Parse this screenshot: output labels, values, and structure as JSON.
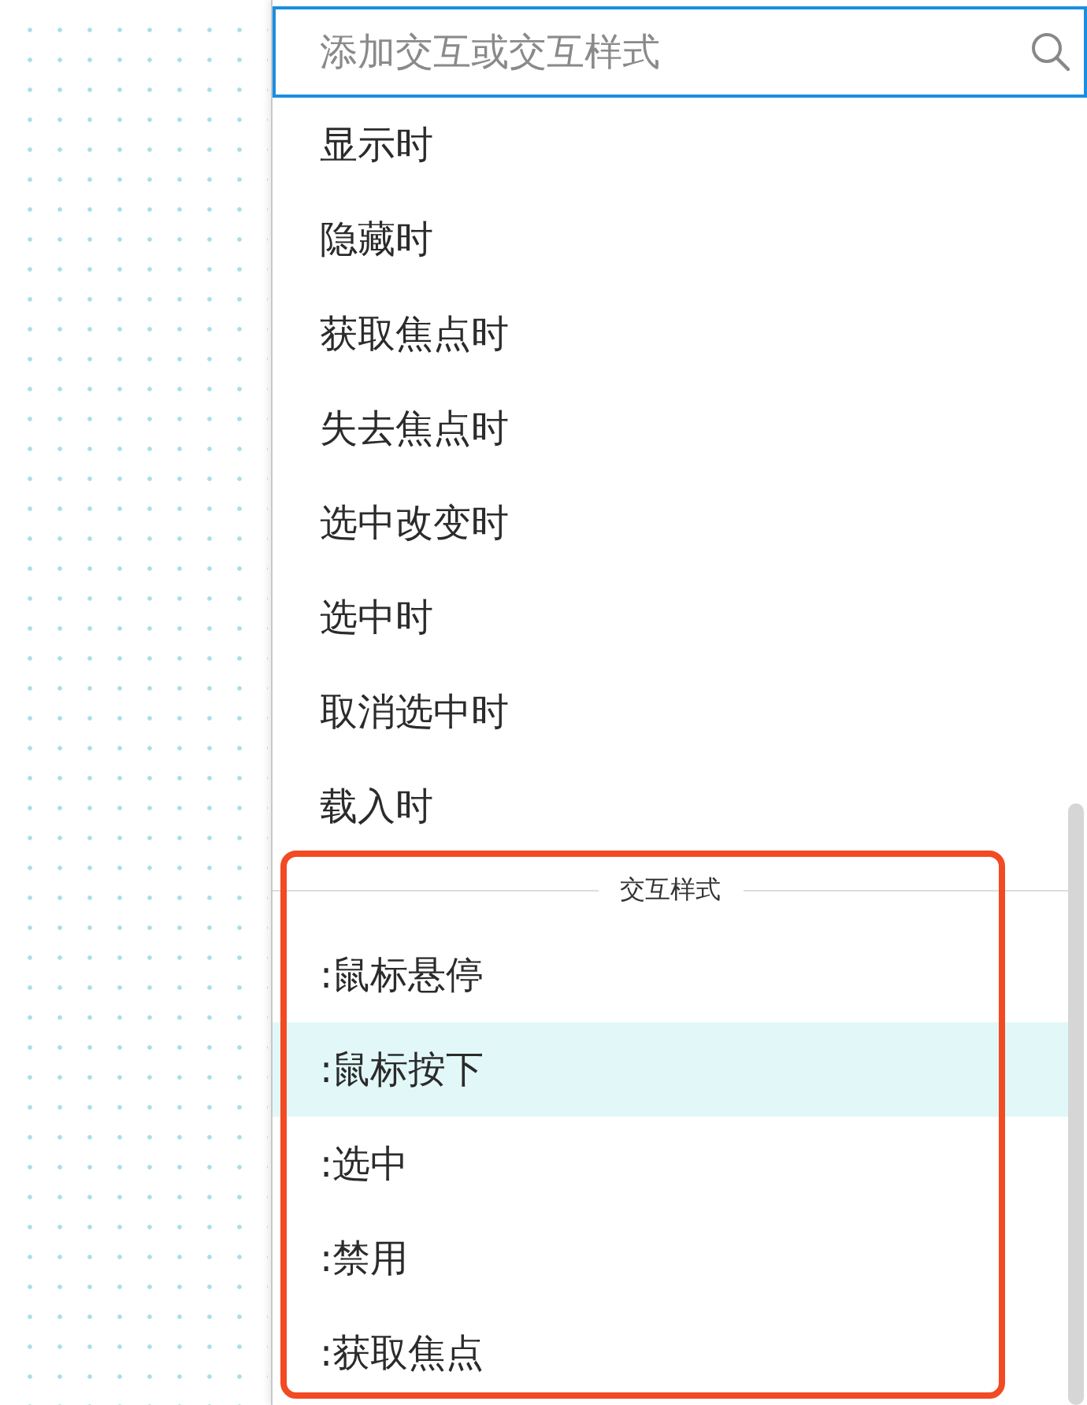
{
  "search": {
    "placeholder": "添加交互或交互样式"
  },
  "events": [
    {
      "label": "显示时"
    },
    {
      "label": "隐藏时"
    },
    {
      "label": "获取焦点时"
    },
    {
      "label": "失去焦点时"
    },
    {
      "label": "选中改变时"
    },
    {
      "label": "选中时"
    },
    {
      "label": "取消选中时"
    },
    {
      "label": "载入时"
    }
  ],
  "style_section": {
    "title": "交互样式",
    "items": [
      {
        "label": ":鼠标悬停",
        "selected": false
      },
      {
        "label": ":鼠标按下",
        "selected": true
      },
      {
        "label": ":选中",
        "selected": false
      },
      {
        "label": ":禁用",
        "selected": false
      },
      {
        "label": ":获取焦点",
        "selected": false
      }
    ]
  }
}
